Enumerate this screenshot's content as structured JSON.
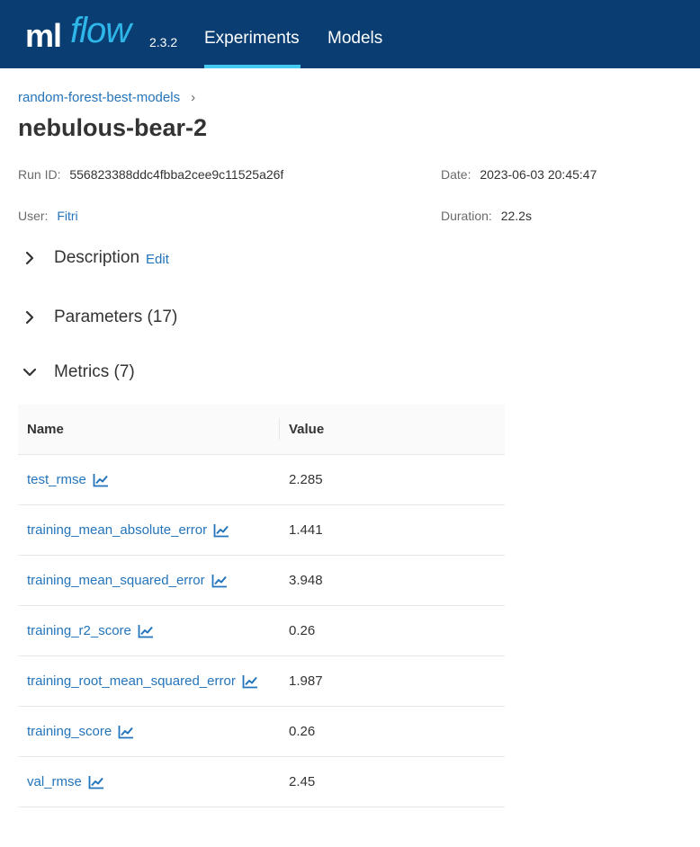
{
  "app": {
    "logo_ml": "ml",
    "logo_flow": "flow",
    "version": "2.3.2",
    "nav": [
      {
        "label": "Experiments",
        "active": true
      },
      {
        "label": "Models",
        "active": false
      }
    ],
    "colors": {
      "navbar": "#0a3e73",
      "accent": "#43c9ed",
      "link": "#2374bb"
    }
  },
  "breadcrumb": {
    "experiment": "random-forest-best-models",
    "separator": "›"
  },
  "run": {
    "title": "nebulous-bear-2",
    "run_id_label": "Run ID:",
    "run_id": "556823388ddc4fbba2cee9c11525a26f",
    "date_label": "Date:",
    "date": "2023-06-03 20:45:47",
    "user_label": "User:",
    "user": "Fitri",
    "duration_label": "Duration:",
    "duration": "22.2s"
  },
  "sections": {
    "description": {
      "title": "Description",
      "edit_label": "Edit",
      "expanded": false,
      "icon": "chevron-right-icon"
    },
    "parameters": {
      "title": "Parameters (17)",
      "expanded": false,
      "icon": "chevron-right-icon"
    },
    "metrics": {
      "title": "Metrics (7)",
      "expanded": true,
      "icon": "chevron-down-icon"
    }
  },
  "metrics_table": {
    "columns": {
      "name": "Name",
      "value": "Value"
    },
    "row_icon": "line-chart-icon",
    "rows": [
      {
        "name": "test_rmse",
        "value": "2.285"
      },
      {
        "name": "training_mean_absolute_error",
        "value": "1.441"
      },
      {
        "name": "training_mean_squared_error",
        "value": "3.948"
      },
      {
        "name": "training_r2_score",
        "value": "0.26"
      },
      {
        "name": "training_root_mean_squared_error",
        "value": "1.987"
      },
      {
        "name": "training_score",
        "value": "0.26"
      },
      {
        "name": "val_rmse",
        "value": "2.45"
      }
    ]
  }
}
